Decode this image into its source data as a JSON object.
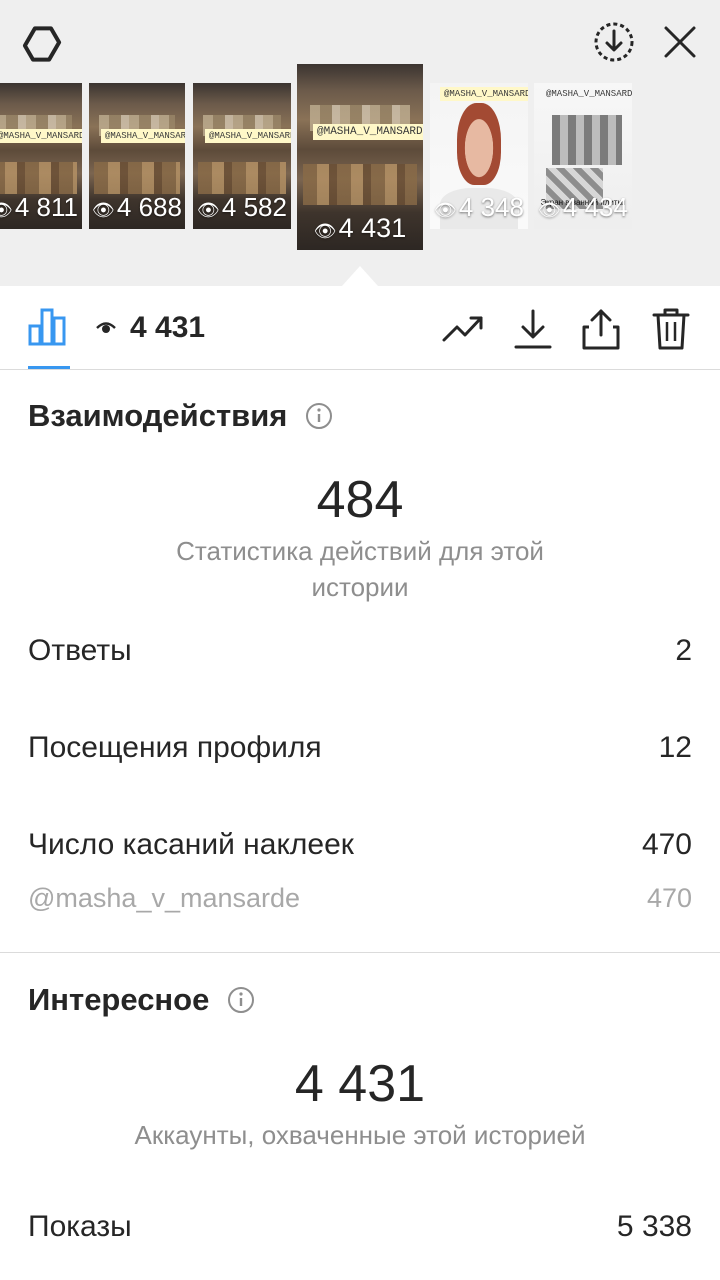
{
  "header": {
    "icons": {
      "settings": "gear-icon",
      "save": "download-circle-icon",
      "close": "close-icon"
    }
  },
  "stories": [
    {
      "views": "4 811",
      "tag": "@MASHA_V_MANSARDE",
      "kind": "shelf"
    },
    {
      "views": "4 688",
      "tag": "@MASHA_V_MANSARDE",
      "kind": "shelf"
    },
    {
      "views": "4 582",
      "tag": "@MASHA_V_MANSARDE",
      "kind": "shelf"
    },
    {
      "views": "4 431",
      "tag": "@MASHA_V_MANSARDE",
      "kind": "shelf",
      "active": true
    },
    {
      "views": "4 348",
      "tag": "@MASHA_V_MANSARDE",
      "kind": "face"
    },
    {
      "views": "4 434",
      "tag": "@MASHA_V_MANSARDE",
      "kind": "room",
      "caption": "Экран в ванной плитки"
    }
  ],
  "toolbar": {
    "views": "4 431",
    "icons": [
      "bar-chart-icon",
      "eye-icon",
      "trending-icon",
      "download-icon",
      "share-icon",
      "trash-icon"
    ]
  },
  "interactions": {
    "title": "Взаимодействия",
    "total": "484",
    "caption": "Статистика действий для этой истории",
    "rows": [
      {
        "label": "Ответы",
        "value": "2"
      },
      {
        "label": "Посещения профиля",
        "value": "12"
      },
      {
        "label": "Число касаний наклеек",
        "value": "470"
      }
    ],
    "sub_row": {
      "label": "@masha_v_mansarde",
      "value": "470"
    }
  },
  "discovery": {
    "title": "Интересное",
    "total": "4 431",
    "caption": "Аккаунты, охваченные этой историей",
    "rows": [
      {
        "label": "Показы",
        "value": "5 338"
      }
    ]
  },
  "colors": {
    "accent": "#3897f0",
    "text": "#262626",
    "muted": "#8e8e8e",
    "divider": "#dbdbdb"
  }
}
